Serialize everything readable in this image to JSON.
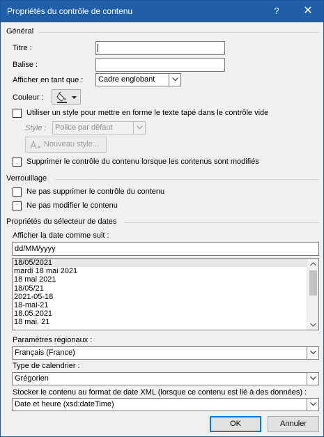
{
  "window": {
    "title": "Propriétés du contrôle de contenu",
    "help": "?",
    "close": "✕"
  },
  "general": {
    "section": "Général",
    "title_label": "Titre :",
    "title_value": "",
    "tag_label": "Balise :",
    "tag_value": "",
    "display_label": "Afficher en tant que :",
    "display_value": "Cadre englobant",
    "color_label": "Couleur :",
    "use_style_label": "Utiliser un style pour mettre en forme le texte tapé dans le contrôle vide",
    "style_label": "Style :",
    "style_value": "Police par défaut",
    "new_style_label": "Nouveau style...",
    "remove_label": "Supprimer le contrôle du contenu lorsque les contenus sont modifiés"
  },
  "locking": {
    "section": "Verrouillage",
    "no_delete_label": "Ne pas supprimer le contrôle du contenu",
    "no_edit_label": "Ne pas modifier le contenu"
  },
  "date_picker": {
    "section": "Propriétés du sélecteur de dates",
    "format_label": "Afficher la date comme suit :",
    "format_value": "dd/MM/yyyy",
    "formats": [
      "18/05/2021",
      "mardi 18 mai 2021",
      "18 mai 2021",
      "18/05/21",
      "2021-05-18",
      "18-mai-21",
      "18.05.2021",
      "18 mai. 21"
    ],
    "locale_label": "Paramètres régionaux :",
    "locale_value": "Français (France)",
    "calendar_label": "Type de calendrier :",
    "calendar_value": "Grégorien",
    "xml_label": "Stocker le contenu au format de date XML (lorsque ce contenu est lié à des données) :",
    "xml_value": "Date et heure (xsd:dateTime)"
  },
  "buttons": {
    "ok": "OK",
    "cancel": "Annuler"
  }
}
